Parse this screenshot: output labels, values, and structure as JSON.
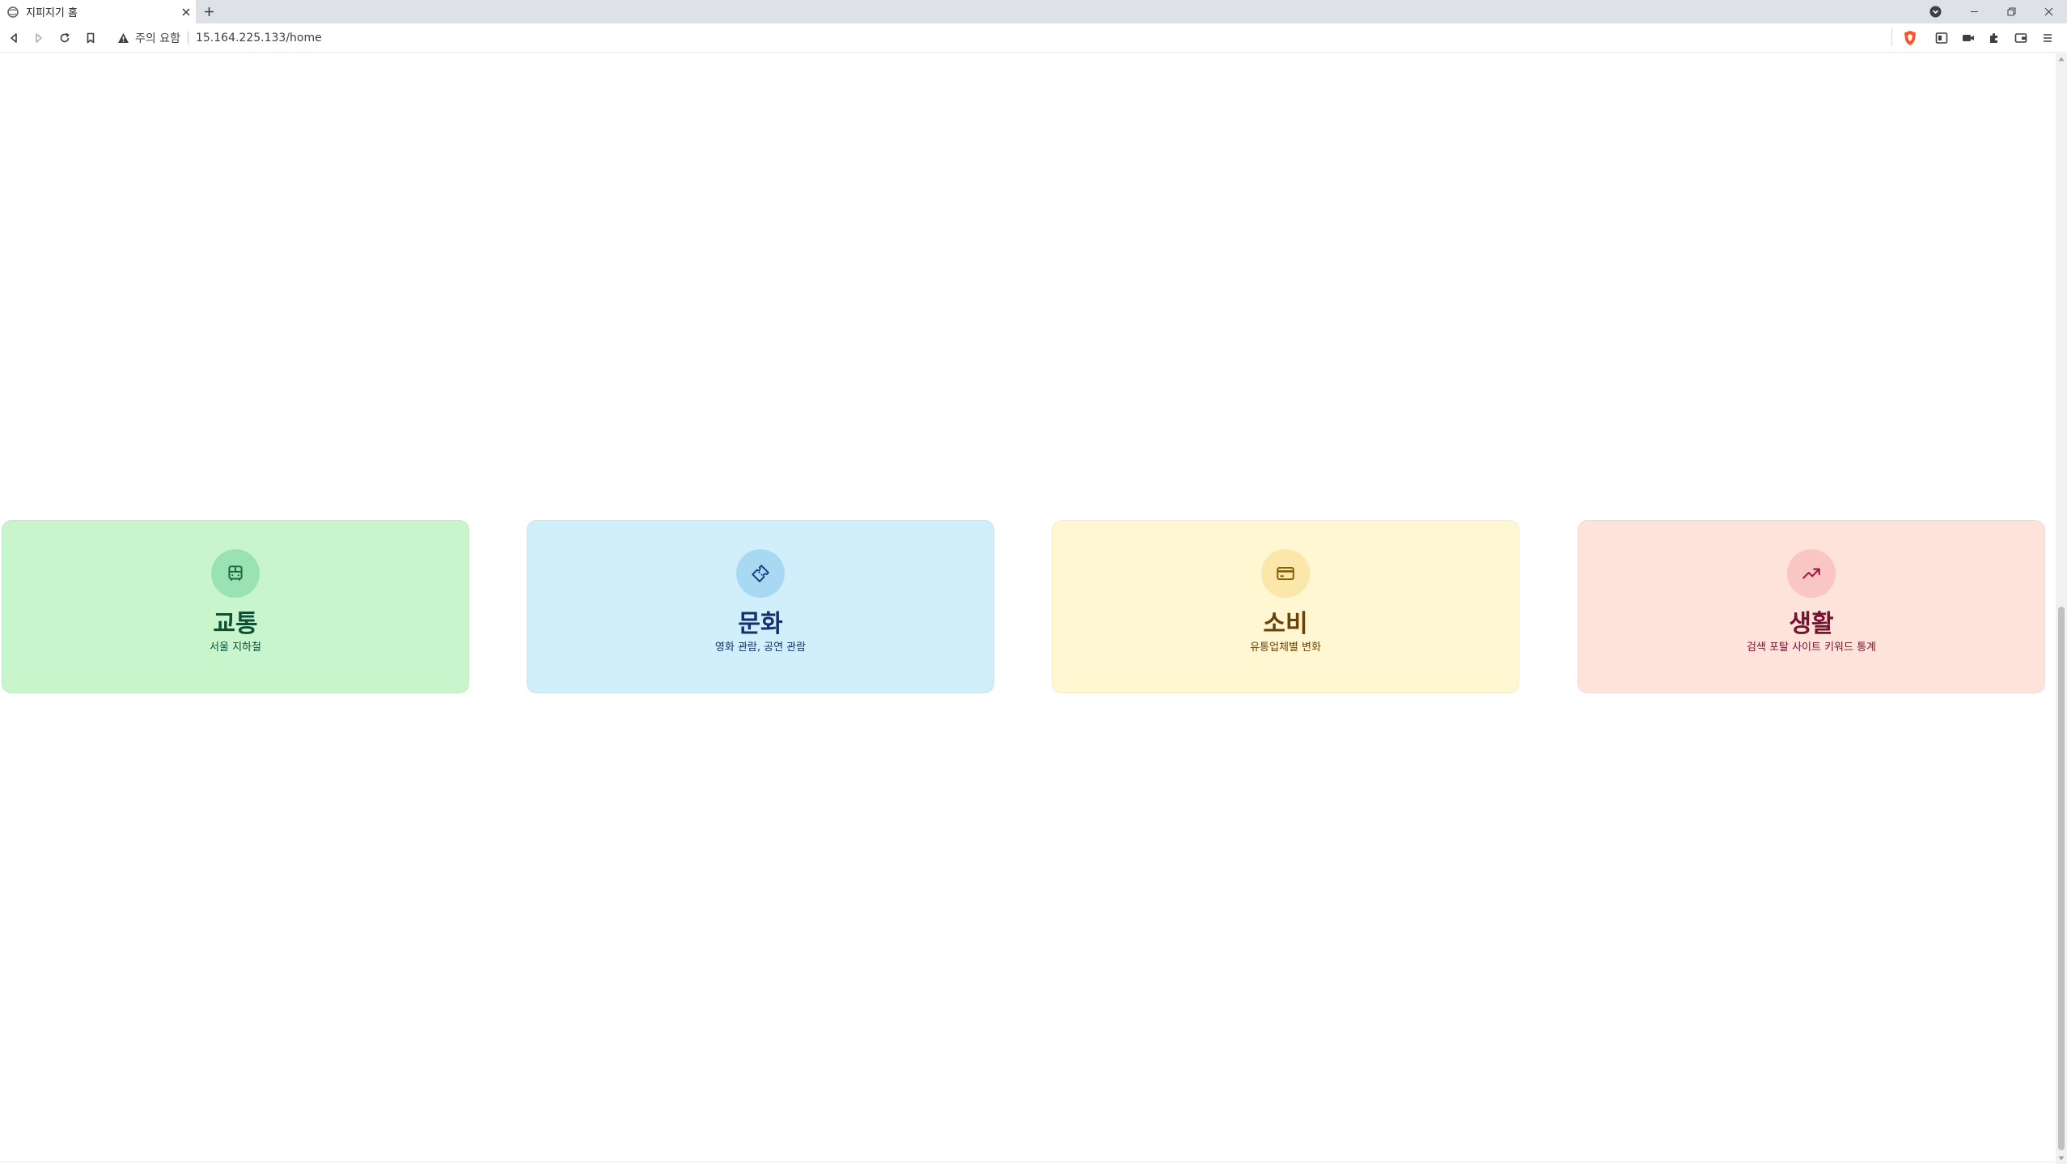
{
  "browser": {
    "tab": {
      "title": "지피지기 홈"
    },
    "address_bar": {
      "security_label": "주의 요함",
      "url": "15.164.225.133/home"
    }
  },
  "colors": {
    "card_transport": "#c8f5cb",
    "card_culture": "#d0effb",
    "card_consumption": "#fef7d1",
    "card_life": "#fde3d9"
  },
  "cards": [
    {
      "title": "교통",
      "subtitle": "서울 지하철",
      "icon": "subway-icon"
    },
    {
      "title": "문화",
      "subtitle": "영화 관람, 공연 관람",
      "icon": "ticket-icon"
    },
    {
      "title": "소비",
      "subtitle": "유통업체별 변화",
      "icon": "credit-card-icon"
    },
    {
      "title": "생활",
      "subtitle": "검색 포탈 사이트 키워드 통계",
      "icon": "trending-up-icon"
    }
  ]
}
